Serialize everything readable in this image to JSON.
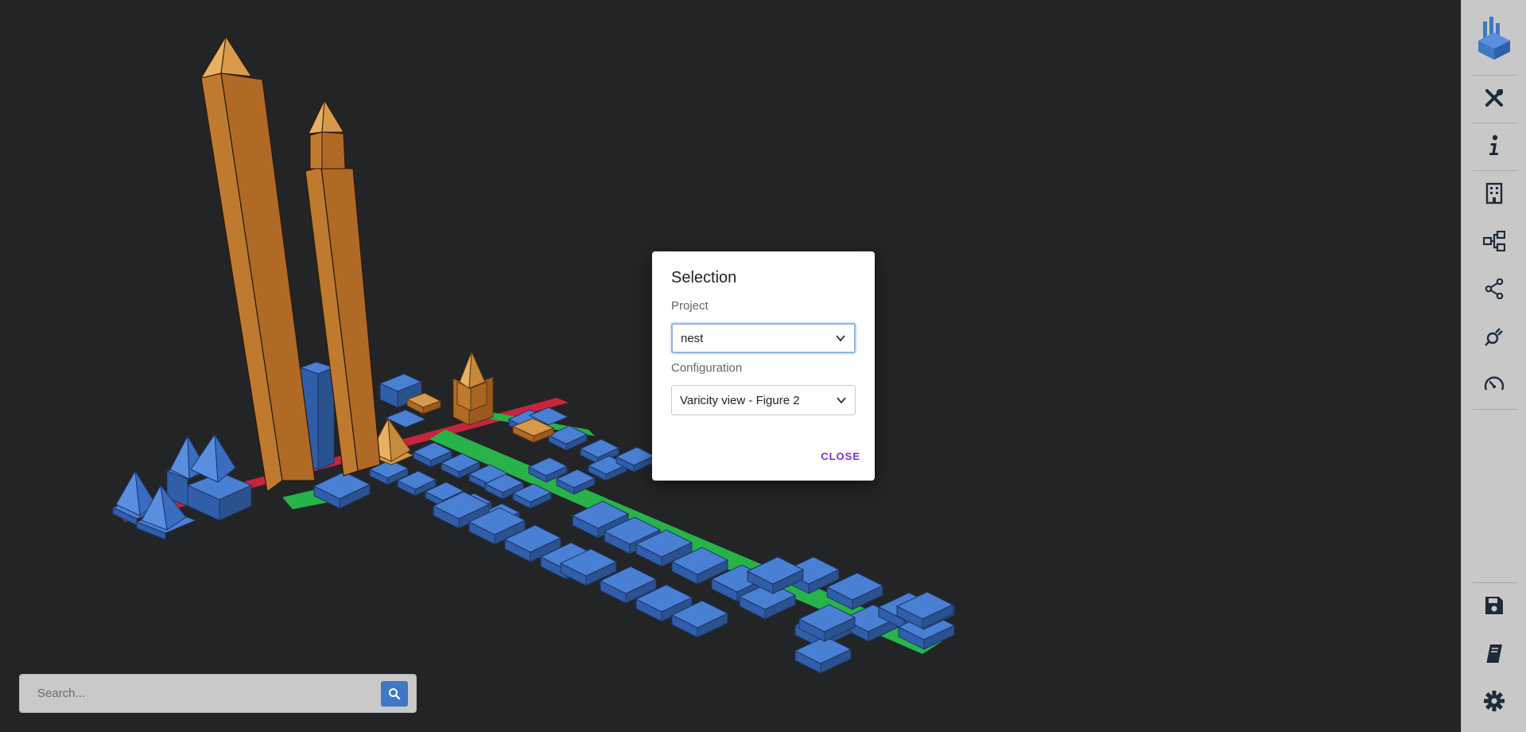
{
  "dialog": {
    "title": "Selection",
    "project_label": "Project",
    "project_value": "nest",
    "configuration_label": "Configuration",
    "configuration_value": "Varicity view - Figure 2",
    "close_label": "CLOSE"
  },
  "search": {
    "placeholder": "Search..."
  },
  "colors": {
    "background": "#232426",
    "building_blue": "#3f72c6",
    "building_orange": "#c17d35",
    "road_green": "#27b34a",
    "road_red": "#c8243d",
    "sidebar": "#c8c8c8",
    "close_accent": "#7a2fd4"
  },
  "sidebar": {
    "top_items": [
      "logo-icon",
      "tools-icon",
      "info-icon",
      "building-icon",
      "hierarchy-icon",
      "share-icon",
      "plug-icon",
      "speedometer-icon"
    ],
    "bottom_items": [
      "save-icon",
      "book-icon",
      "gear-icon"
    ]
  }
}
